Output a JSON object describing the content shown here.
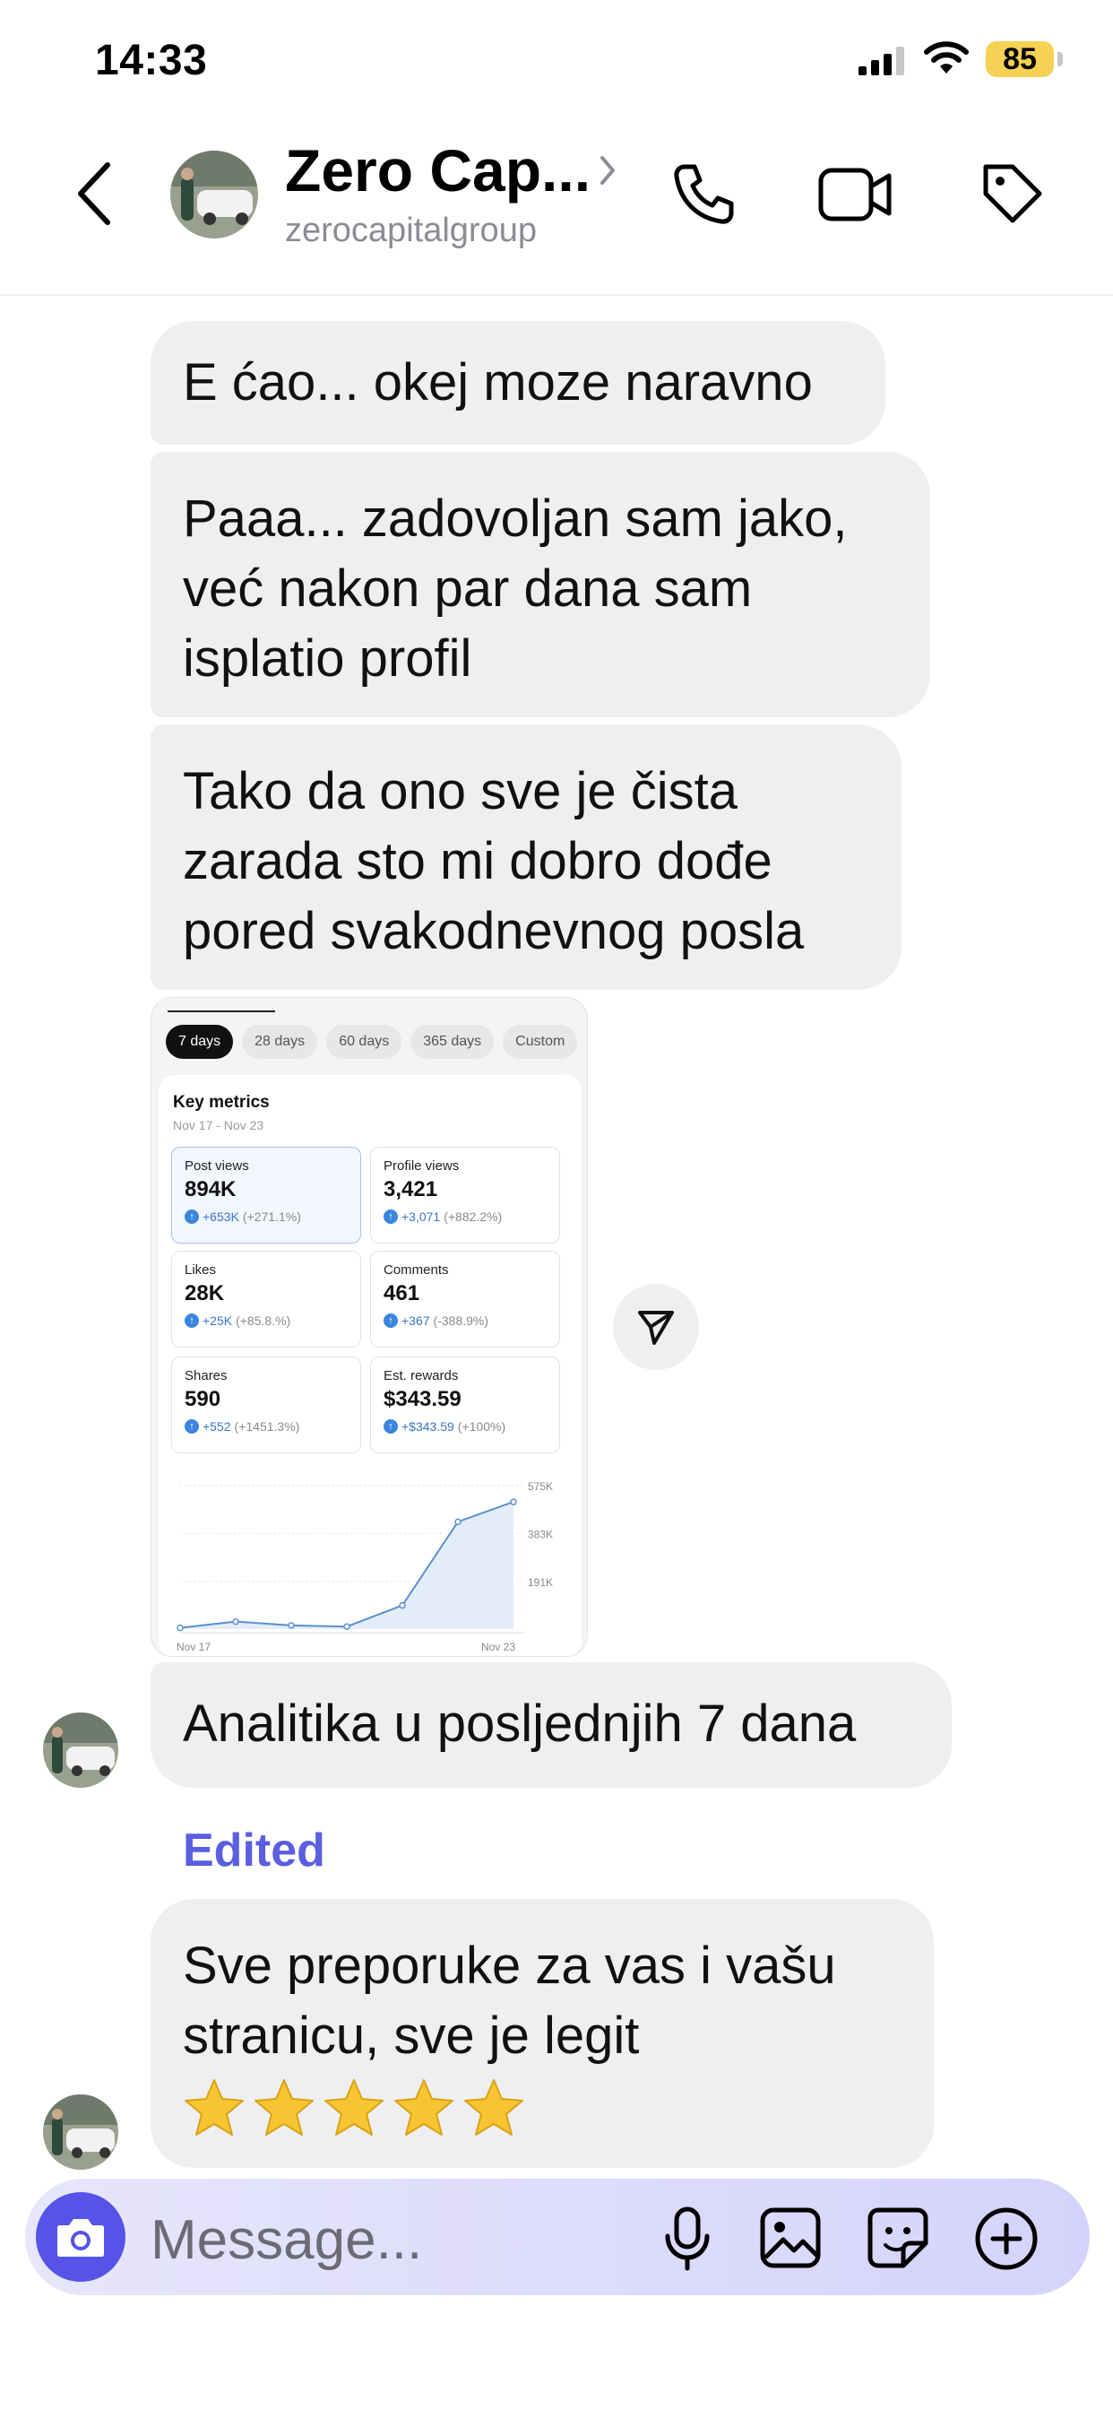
{
  "status_bar": {
    "time": "14:33",
    "battery": "85"
  },
  "header": {
    "name": "Zero Cap...",
    "handle": "zerocapitalgroup",
    "icons": [
      "back-icon",
      "chevron-right-icon",
      "phone-icon",
      "video-icon",
      "tag-icon"
    ]
  },
  "messages": [
    {
      "text": "E ćao... okej moze naravno"
    },
    {
      "lines": [
        "Paaa... zadovoljan sam jako,",
        "već nakon par dana sam",
        "isplatio profil"
      ]
    },
    {
      "lines": [
        "Tako da ono sve je čista",
        "zarada sto mi dobro dođe",
        "pored svakodnevnog posla"
      ]
    },
    {
      "text": "Analitika u posljednjih 7 dana"
    },
    {
      "edited": "Edited",
      "lines": [
        "Sve preporuke za vas i vašu",
        "stranicu, sve je legit"
      ],
      "stars": 5
    }
  ],
  "shared_image": {
    "chips": [
      "7 days",
      "28 days",
      "60 days",
      "365 days",
      "Custom"
    ],
    "selected_chip": "7 days",
    "title": "Key metrics",
    "range": "Nov 17 - Nov 23",
    "metrics": [
      {
        "label": "Post views",
        "value": "894K",
        "delta": "+653K",
        "pct": "(+271.1%)"
      },
      {
        "label": "Profile views",
        "value": "3,421",
        "delta": "+3,071",
        "pct": "(+882.2%)"
      },
      {
        "label": "Likes",
        "value": "28K",
        "delta": "+25K",
        "pct": "(+85.8.%)"
      },
      {
        "label": "Comments",
        "value": "461",
        "delta": "+367",
        "pct": "(-388.9%)"
      },
      {
        "label": "Shares",
        "value": "590",
        "delta": "+552",
        "pct": "(+1451.3%)"
      },
      {
        "label": "Est. rewards",
        "value": "$343.59",
        "delta": "+$343.59",
        "pct": "(+100%)"
      }
    ],
    "chart": {
      "y_ticks": [
        "575K",
        "383K",
        "191K"
      ],
      "x_ticks": [
        "Nov 17",
        "Nov 23"
      ],
      "values": [
        5,
        30,
        15,
        10,
        95,
        430,
        510
      ],
      "ylim": [
        0,
        575
      ]
    }
  },
  "composer": {
    "placeholder": "Message..."
  },
  "colors": {
    "accent": "#5553e8",
    "bubble": "#efeff2",
    "edited": "#5a5ee0",
    "battery": "#f5d154"
  }
}
